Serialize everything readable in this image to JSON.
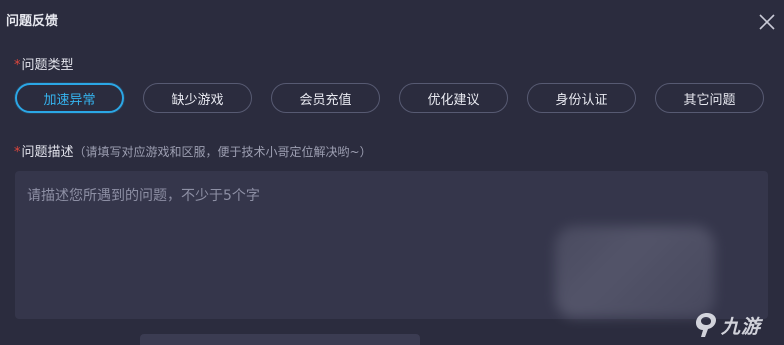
{
  "dialog": {
    "title": "问题反馈",
    "close_icon": "close-icon"
  },
  "category": {
    "required_mark": "*",
    "label": "问题类型",
    "options": [
      "加速异常",
      "缺少游戏",
      "会员充值",
      "优化建议",
      "身份认证",
      "其它问题"
    ],
    "selected": "加速异常"
  },
  "description": {
    "required_mark": "*",
    "label": "问题描述",
    "hint": "（请填写对应游戏和区服，便于技术小哥定位解决哟~）",
    "placeholder": "请描述您所遇到的问题，不少于5个字",
    "value": ""
  },
  "watermark": {
    "text": "九游",
    "icon": "jiuyou-logo-icon"
  },
  "colors": {
    "background": "#2b2c3e",
    "accent": "#2ba7e6",
    "required": "#e0473d"
  }
}
